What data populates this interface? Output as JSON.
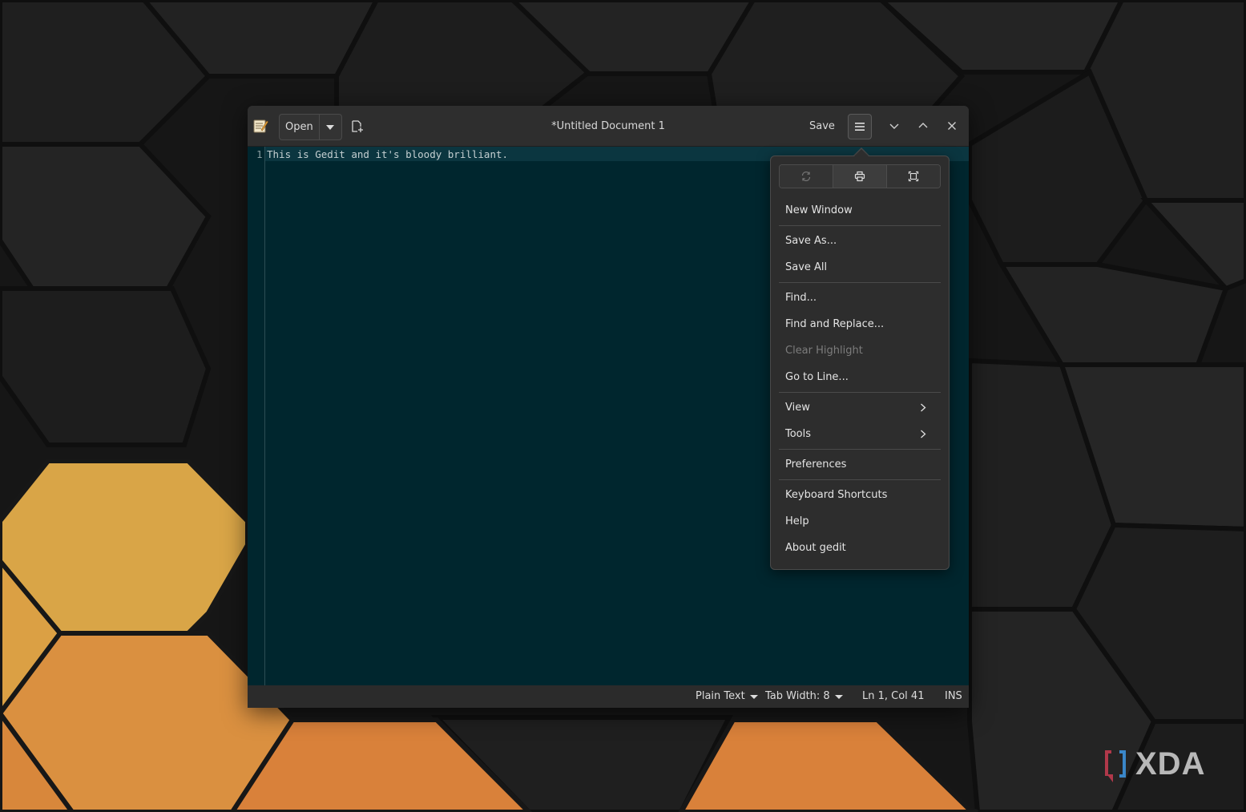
{
  "window": {
    "title": "*Untitled Document 1",
    "open_label": "Open",
    "save_label": "Save"
  },
  "editor": {
    "line_number": "1",
    "line_text": "This is Gedit and it's bloody brilliant."
  },
  "statusbar": {
    "language": "Plain Text",
    "tab_width": "Tab Width: 8",
    "cursor": "Ln 1, Col 41",
    "mode": "INS"
  },
  "menu": {
    "icons": [
      "reload-icon",
      "print-icon",
      "fullscreen-icon"
    ],
    "items": [
      {
        "label": "New Window"
      },
      {
        "label": "Save As..."
      },
      {
        "label": "Save All"
      },
      {
        "label": "Find..."
      },
      {
        "label": "Find and Replace..."
      },
      {
        "label": "Clear Highlight",
        "disabled": true
      },
      {
        "label": "Go to Line..."
      },
      {
        "label": "View",
        "submenu": true
      },
      {
        "label": "Tools",
        "submenu": true
      },
      {
        "label": "Preferences"
      },
      {
        "label": "Keyboard Shortcuts"
      },
      {
        "label": "Help"
      },
      {
        "label": "About gedit"
      }
    ]
  },
  "watermark": {
    "text": "XDA"
  },
  "colors": {
    "editor_bg": "#00262e",
    "honeycomb_dark": "#1e1e1e",
    "honeycomb_yellow": "#d9a547",
    "honeycomb_orange": "#d9813a"
  }
}
